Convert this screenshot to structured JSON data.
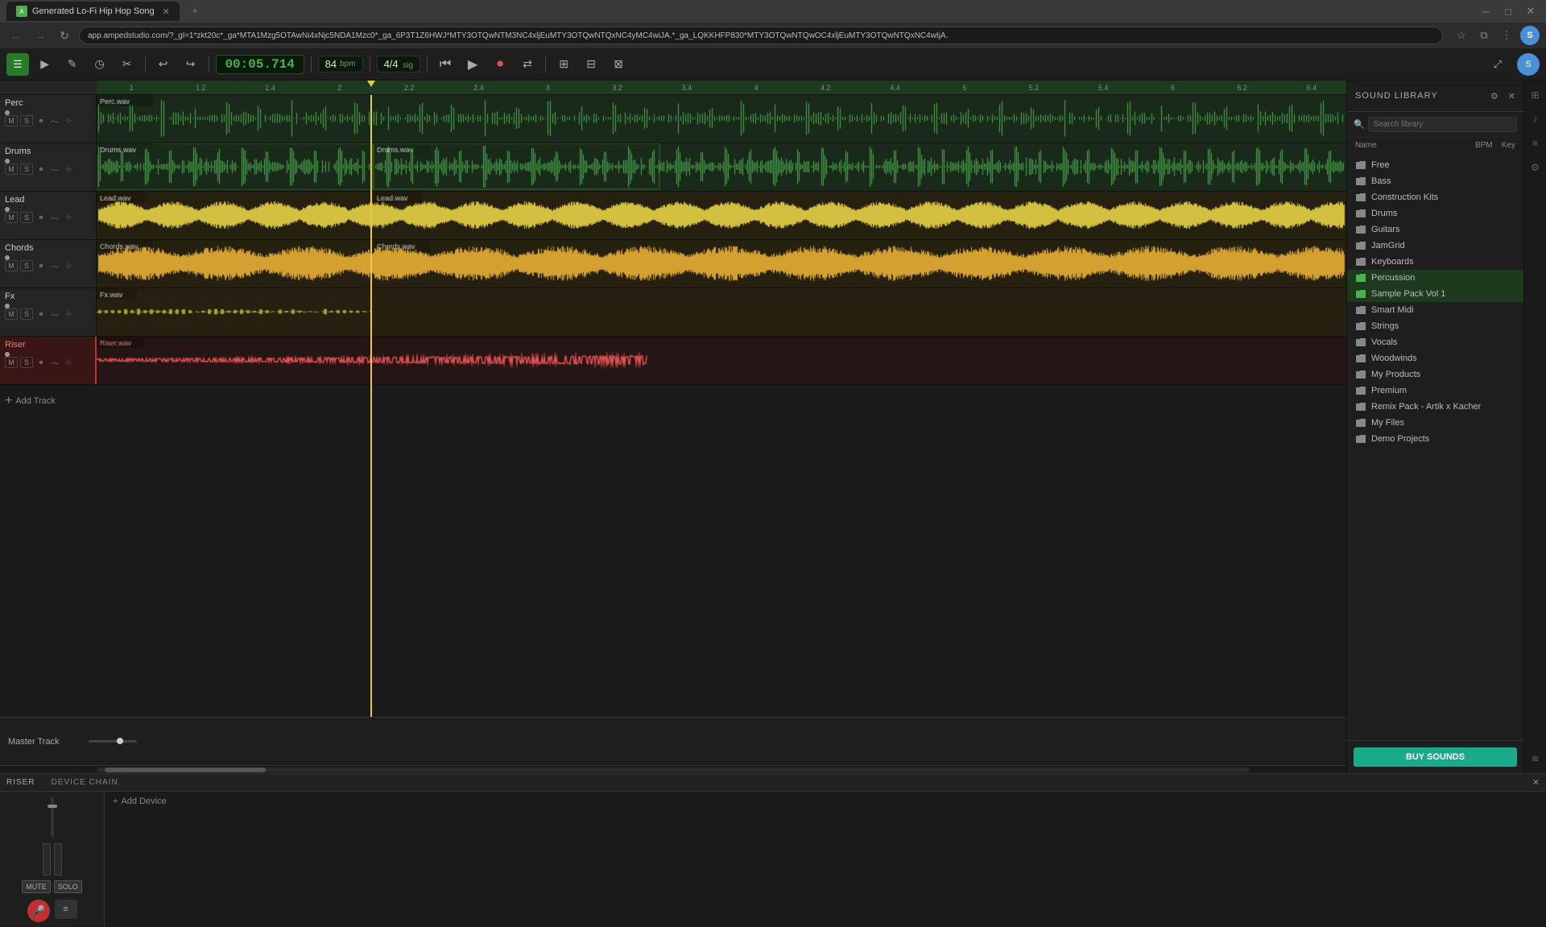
{
  "browser": {
    "tab_title": "Generated Lo-Fi Hip Hop Song",
    "url": "app.ampedstudio.com/?_gl=1*zkt20c*_ga*MTA1Mzg5OTAwNi4xNjc5NDA1Mzc0*_ga_6P3T1Z6HWJ*MTY3OTQwNTM3NC4xljEuMTY3OTQwNTQxNC4yMC4wiJA.*_ga_LQKKHFP830*MTY3OTQwNTQwOC4xljEuMTY3OTQwNTQxNC4wIjA."
  },
  "toolbar": {
    "time": "00:05.714",
    "bpm": "84",
    "bpm_label": "bpm",
    "sig": "4/4",
    "sig_label": "sig"
  },
  "tracks": [
    {
      "id": "perc",
      "name": "Perc",
      "clip1": "Perc.wav",
      "color": "#4CAF50",
      "selected": false
    },
    {
      "id": "drums",
      "name": "Drums",
      "clip1": "Drums.wav",
      "clip2": "Drums.wav",
      "color": "#4CAF50",
      "selected": false
    },
    {
      "id": "lead",
      "name": "Lead",
      "clip1": "Lead.wav",
      "clip2": "Lead.wav",
      "color": "#d4c040",
      "selected": false
    },
    {
      "id": "chords",
      "name": "Chords",
      "clip1": "Chords.wav",
      "clip2": "Chords.wav",
      "color": "#d4a030",
      "selected": false
    },
    {
      "id": "fx",
      "name": "Fx",
      "clip1": "Fx.wav",
      "color": "#d4c040",
      "selected": false
    },
    {
      "id": "riser",
      "name": "Riser",
      "clip1": "Riser.wav",
      "color": "#e05050",
      "selected": true
    }
  ],
  "add_track_label": "Add Track",
  "master_track_label": "Master Track",
  "sound_library": {
    "title": "SOUND LIBRARY",
    "search_placeholder": "Search library",
    "col_name": "Name",
    "col_bpm": "BPM",
    "col_key": "Key",
    "items": [
      {
        "name": "Free",
        "type": "folder"
      },
      {
        "name": "Bass",
        "type": "folder"
      },
      {
        "name": "Construction Kits",
        "type": "folder"
      },
      {
        "name": "Drums",
        "type": "folder"
      },
      {
        "name": "Guitars",
        "type": "folder"
      },
      {
        "name": "JamGrid",
        "type": "folder"
      },
      {
        "name": "Keyboards",
        "type": "folder"
      },
      {
        "name": "Percussion",
        "type": "folder",
        "selected": true
      },
      {
        "name": "Sample Pack Vol 1",
        "type": "folder",
        "selected": true
      },
      {
        "name": "Smart Midi",
        "type": "folder"
      },
      {
        "name": "Strings",
        "type": "folder"
      },
      {
        "name": "Vocals",
        "type": "folder"
      },
      {
        "name": "Woodwinds",
        "type": "folder"
      },
      {
        "name": "My Products",
        "type": "folder"
      },
      {
        "name": "Premium",
        "type": "folder"
      },
      {
        "name": "Remix Pack - Artik x Kacher",
        "type": "folder"
      },
      {
        "name": "My Files",
        "type": "folder"
      },
      {
        "name": "Demo Projects",
        "type": "folder"
      }
    ],
    "buy_sounds_label": "BUY SOUNDS"
  },
  "bottom_panel": {
    "section1": "RISER",
    "section2": "DEVICE CHAIN",
    "mute_label": "MUTE",
    "solo_label": "SOLO",
    "add_device_label": "Add Device"
  }
}
